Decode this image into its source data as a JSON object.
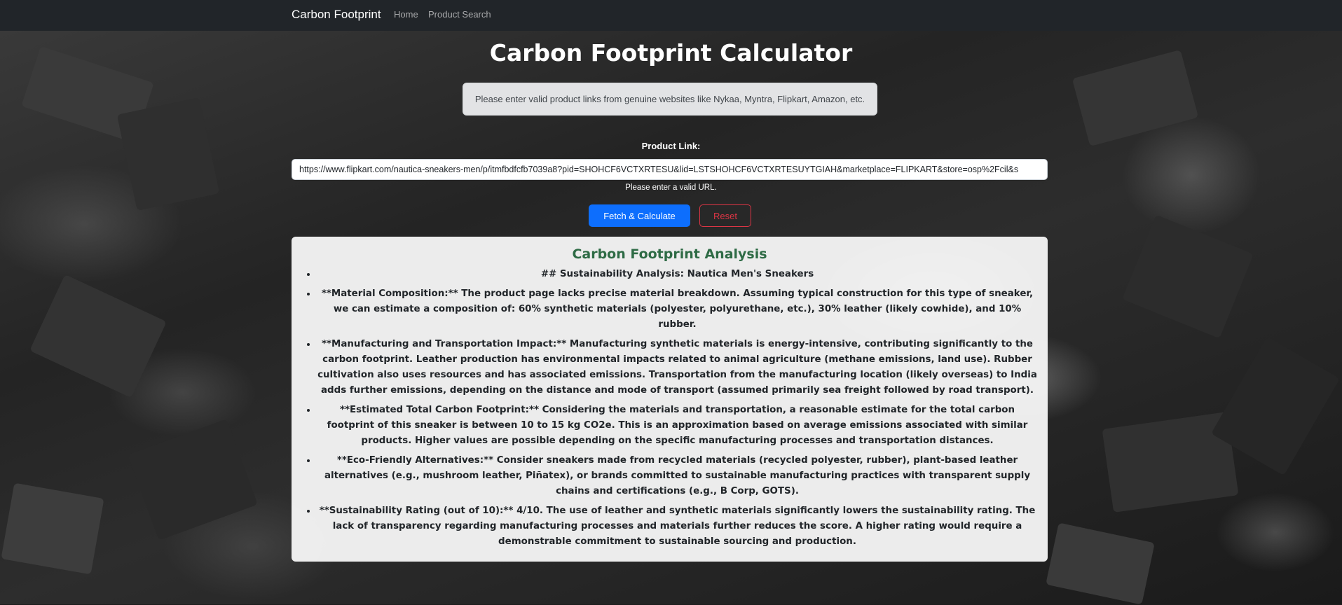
{
  "navbar": {
    "brand": "Carbon Footprint",
    "links": [
      "Home",
      "Product Search"
    ]
  },
  "page": {
    "title": "Carbon Footprint Calculator",
    "alert": "Please enter valid product links from genuine websites like Nykaa, Myntra, Flipkart, Amazon, etc."
  },
  "form": {
    "label": "Product Link:",
    "url_value": "https://www.flipkart.com/nautica-sneakers-men/p/itmfbdfcfb7039a8?pid=SHOHCF6VCTXRTESU&lid=LSTSHOHCF6VCTXRTESUYTGIAH&marketplace=FLIPKART&store=osp%2Fcil&s",
    "validation_message": "Please enter a valid URL.",
    "fetch_label": "Fetch & Calculate",
    "reset_label": "Reset"
  },
  "analysis": {
    "title": "Carbon Footprint Analysis",
    "items": [
      "## Sustainability Analysis: Nautica Men's Sneakers",
      "**Material Composition:** The product page lacks precise material breakdown. Assuming typical construction for this type of sneaker, we can estimate a composition of: 60% synthetic materials (polyester, polyurethane, etc.), 30% leather (likely cowhide), and 10% rubber.",
      "**Manufacturing and Transportation Impact:** Manufacturing synthetic materials is energy-intensive, contributing significantly to the carbon footprint. Leather production has environmental impacts related to animal agriculture (methane emissions, land use). Rubber cultivation also uses resources and has associated emissions. Transportation from the manufacturing location (likely overseas) to India adds further emissions, depending on the distance and mode of transport (assumed primarily sea freight followed by road transport).",
      "**Estimated Total Carbon Footprint:** Considering the materials and transportation, a reasonable estimate for the total carbon footprint of this sneaker is between 10 to 15 kg CO2e. This is an approximation based on average emissions associated with similar products. Higher values are possible depending on the specific manufacturing processes and transportation distances.",
      "**Eco-Friendly Alternatives:** Consider sneakers made from recycled materials (recycled polyester, rubber), plant-based leather alternatives (e.g., mushroom leather, Piñatex), or brands committed to sustainable manufacturing practices with transparent supply chains and certifications (e.g., B Corp, GOTS).",
      "**Sustainability Rating (out of 10):** 4/10. The use of leather and synthetic materials significantly lowers the sustainability rating. The lack of transparency regarding manufacturing processes and materials further reduces the score. A higher rating would require a demonstrable commitment to sustainable sourcing and production."
    ]
  },
  "colors": {
    "navbar_bg": "#212529",
    "primary": "#0d6efd",
    "danger": "#dc3545",
    "analysis_title": "#2e6b45",
    "alert_bg": "#e2e3e5"
  }
}
